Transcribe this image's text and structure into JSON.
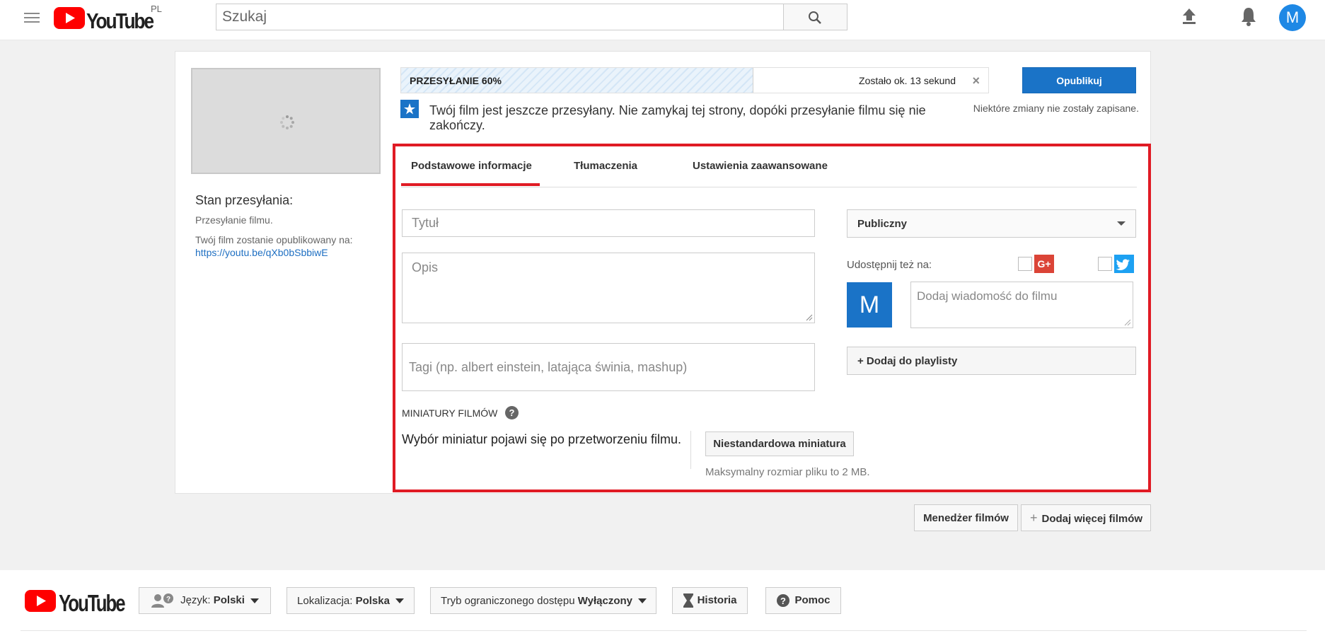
{
  "header": {
    "logo_text": "YouTube",
    "region": "PL",
    "search_placeholder": "Szukaj",
    "avatar_letter": "M"
  },
  "upload": {
    "progress_label": "PRZESYŁANIE 60%",
    "progress_fraction": 0.6,
    "time_remaining": "Zostało ok. 13 sekund",
    "close_symbol": "×",
    "publish_label": "Opublikuj",
    "unsaved_notice": "Niektóre zmiany nie zostały zapisane.",
    "notice_text": "Twój film jest jeszcze przesyłany. Nie zamykaj tej strony, dopóki przesyłanie filmu się nie zakończy."
  },
  "status": {
    "title": "Stan przesyłania:",
    "state": "Przesyłanie filmu.",
    "publish_info": "Twój film zostanie opublikowany na:",
    "link": "https://youtu.be/qXb0bSbbiwE"
  },
  "tabs": [
    {
      "label": "Podstawowe informacje",
      "active": true
    },
    {
      "label": "Tłumaczenia",
      "active": false
    },
    {
      "label": "Ustawienia zaawansowane",
      "active": false
    }
  ],
  "form": {
    "title_placeholder": "Tytuł",
    "description_placeholder": "Opis",
    "tags_placeholder": "Tagi (np. albert einstein, latająca świnia, mashup)",
    "privacy_value": "Publiczny",
    "share_label": "Udostępnij też na:",
    "share_avatar_letter": "M",
    "message_placeholder": "Dodaj wiadomość do filmu",
    "playlist_label": "+ Dodaj do playlisty"
  },
  "thumbnails": {
    "heading": "MINIATURY FILMÓW",
    "help_symbol": "?",
    "info": "Wybór miniatur pojawi się po przetworzeniu filmu.",
    "custom_button": "Niestandardowa miniatura",
    "max_size": "Maksymalny rozmiar pliku to 2 MB."
  },
  "actions": {
    "manager_label": "Menedżer filmów",
    "add_more_label": "Dodaj więcej filmów"
  },
  "footer": {
    "logo_text": "YouTube",
    "language_prefix": "Język:",
    "language_value": "Polski",
    "location_prefix": "Lokalizacja:",
    "location_value": "Polska",
    "restricted_prefix": "Tryb ograniczonego dostępu",
    "restricted_value": "Wyłączony",
    "history_label": "Historia",
    "help_label": "Pomoc"
  },
  "colors": {
    "brand_red": "#ff0000",
    "primary_blue": "#1a73c7",
    "highlight_red": "#e01b24",
    "google_plus": "#db4437",
    "twitter": "#1da1f2"
  }
}
